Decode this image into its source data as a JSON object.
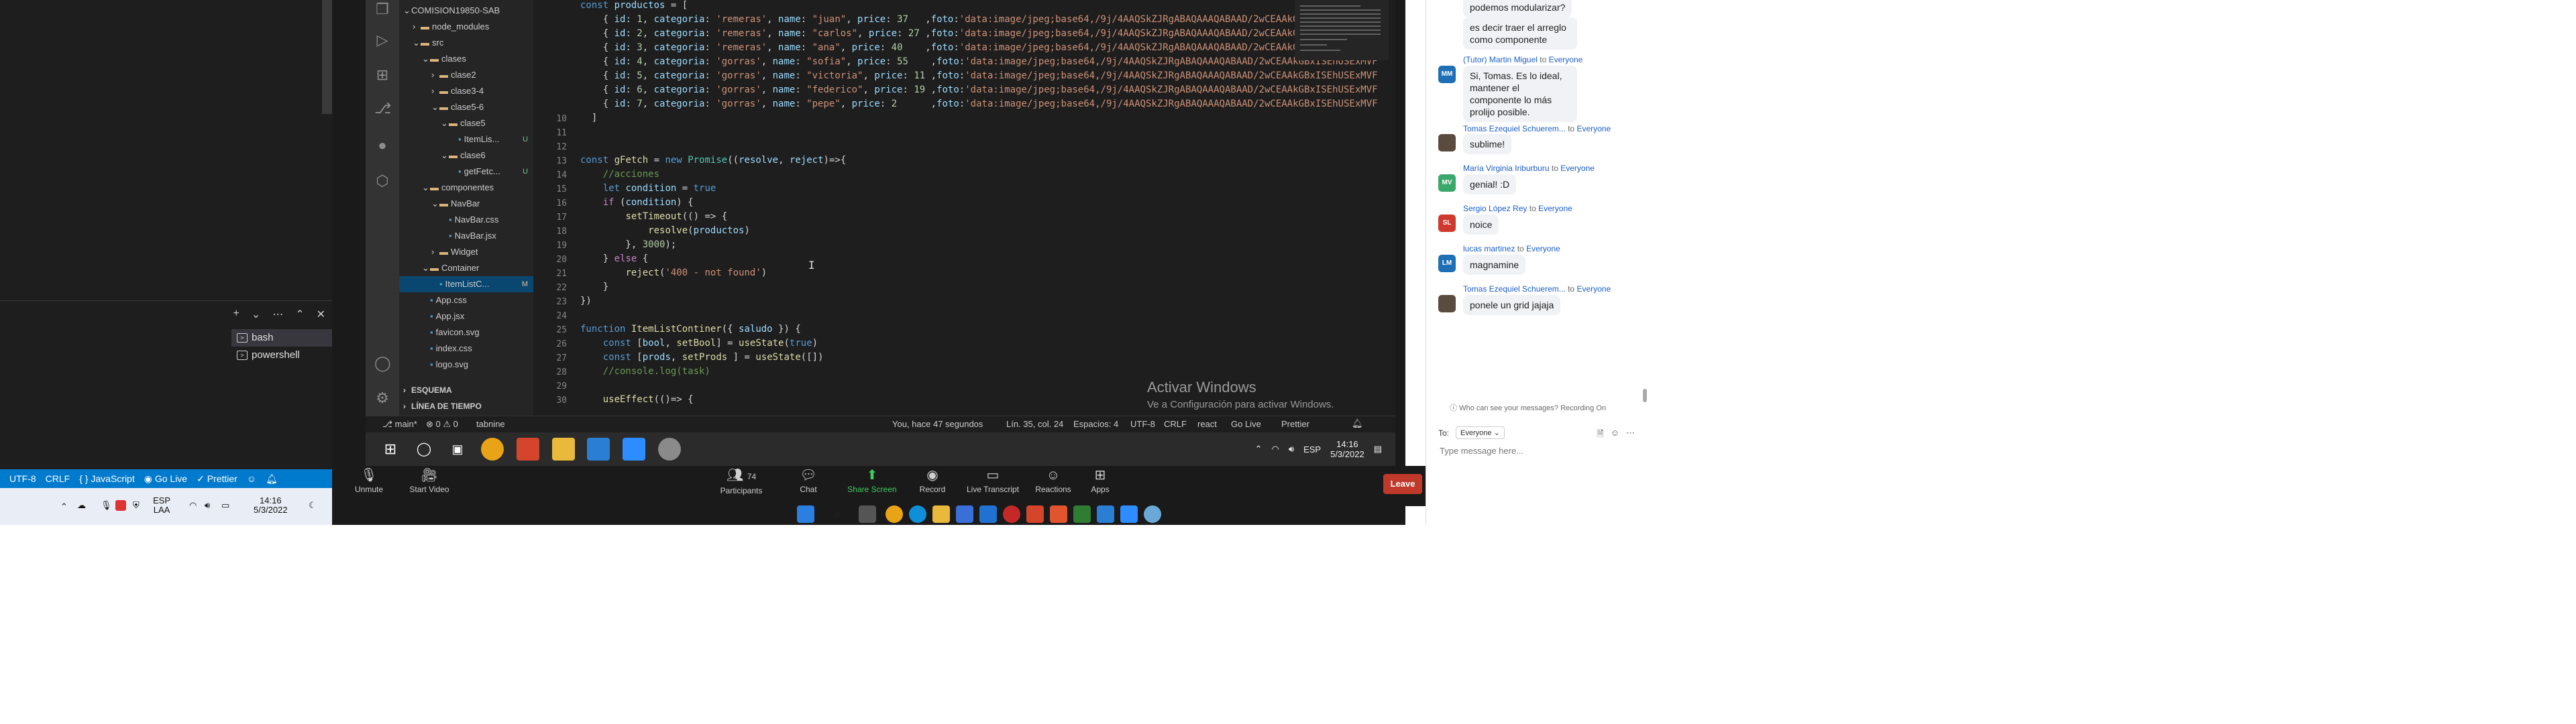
{
  "left_terminal": {
    "toolbar": [
      "+",
      "⌄",
      "⋯",
      "⌃",
      "✕"
    ],
    "items": [
      {
        "label": "bash",
        "active": true
      },
      {
        "label": "powershell",
        "active": false
      }
    ]
  },
  "left_status": {
    "encoding": "UTF-8",
    "eol": "CRLF",
    "language": "JavaScript",
    "golive": "Go Live",
    "prettier": "Prettier"
  },
  "left_taskbar": {
    "lang": "ESP",
    "layout": "LAA",
    "time": "14:16",
    "date": "5/3/2022"
  },
  "remote_explorer": {
    "rows": [
      {
        "text": "COMISION19850-SAB",
        "indent": 0,
        "type": "root"
      },
      {
        "text": "node_modules",
        "indent": 1,
        "type": "folder",
        "collapsed": true
      },
      {
        "text": "src",
        "indent": 1,
        "type": "folder"
      },
      {
        "text": "clases",
        "indent": 2,
        "type": "folder"
      },
      {
        "text": "clase2",
        "indent": 3,
        "type": "folder",
        "collapsed": true
      },
      {
        "text": "clase3-4",
        "indent": 3,
        "type": "folder",
        "collapsed": true
      },
      {
        "text": "clase5-6",
        "indent": 3,
        "type": "folder"
      },
      {
        "text": "clase5",
        "indent": 4,
        "type": "folder"
      },
      {
        "text": "ItemLis...",
        "indent": 5,
        "type": "file",
        "mark": "U"
      },
      {
        "text": "clase6",
        "indent": 4,
        "type": "folder"
      },
      {
        "text": "getFetc...",
        "indent": 5,
        "type": "file",
        "mark": "U"
      },
      {
        "text": "componentes",
        "indent": 2,
        "type": "folder"
      },
      {
        "text": "NavBar",
        "indent": 3,
        "type": "folder"
      },
      {
        "text": "NavBar.css",
        "indent": 4,
        "type": "file"
      },
      {
        "text": "NavBar.jsx",
        "indent": 4,
        "type": "file"
      },
      {
        "text": "Widget",
        "indent": 3,
        "type": "folder",
        "collapsed": true
      },
      {
        "text": "Container",
        "indent": 2,
        "type": "folder"
      },
      {
        "text": "ItemListC...",
        "indent": 3,
        "type": "file",
        "mark": "M",
        "selected": true
      },
      {
        "text": "App.css",
        "indent": 2,
        "type": "file"
      },
      {
        "text": "App.jsx",
        "indent": 2,
        "type": "file"
      },
      {
        "text": "favicon.svg",
        "indent": 2,
        "type": "file"
      },
      {
        "text": "index.css",
        "indent": 2,
        "type": "file"
      },
      {
        "text": "logo.svg",
        "indent": 2,
        "type": "file"
      }
    ],
    "outline": "ESQUEMA",
    "timeline": "LÍNEA DE TIEMPO"
  },
  "remote_code": {
    "line_numbers": [
      "",
      "",
      "",
      "",
      "",
      "",
      "",
      "",
      "10",
      "11",
      "12",
      "13",
      "14",
      "15",
      "16",
      "17",
      "18",
      "19",
      "20",
      "21",
      "22",
      "23",
      "24",
      "25",
      "26",
      "27",
      "28",
      "29",
      "30"
    ],
    "activate_title": "Activar Windows",
    "activate_sub": "Ve a Configuración para activar Windows."
  },
  "remote_status": {
    "branch": "main*",
    "errors": "⊗ 0 ⚠ 0",
    "tabnine": "tabnine",
    "blame": "You, hace 47 segundos",
    "position": "Lín. 35, col. 24",
    "spaces": "Espacios: 4",
    "encoding": "UTF-8",
    "eol": "CRLF",
    "lang": "react",
    "golive": "Go Live",
    "prettier": "Prettier"
  },
  "remote_tray": {
    "lang": "ESP",
    "time": "14:16",
    "date": "5/3/2022"
  },
  "zoom_controls": {
    "unmute": "Unmute",
    "start_video": "Start Video",
    "participants": "Participants",
    "participants_count": "74",
    "chat": "Chat",
    "share": "Share Screen",
    "record": "Record",
    "transcript": "Live Transcript",
    "reactions": "Reactions",
    "apps": "Apps",
    "leave": "Leave"
  },
  "chat": {
    "messages": [
      {
        "sender": "",
        "to": "",
        "text": "podemos modularizar?",
        "initials": "",
        "color": ""
      },
      {
        "sender": "",
        "to": "",
        "text": "es decir traer el arreglo como componente",
        "initials": "",
        "color": ""
      },
      {
        "sender": "(Tutor) Martin Miguel",
        "to": "Everyone",
        "text": "Si, Tomas. Es lo ideal, mantener el componente lo más prolijo posible.",
        "initials": "MM",
        "color": "#1e6fb5"
      },
      {
        "sender": "Tomas Ezequiel Schuerem...",
        "to": "Everyone",
        "text": "sublime!",
        "initials": "",
        "color": "#5b4b3f"
      },
      {
        "sender": "María Virginia Iriburburu",
        "to": "Everyone",
        "text": "genial! :D",
        "initials": "MV",
        "color": "#3aa86b"
      },
      {
        "sender": "Sergio López Rey",
        "to": "Everyone",
        "text": "noice",
        "initials": "SL",
        "color": "#d03a2e"
      },
      {
        "sender": "lucas martinez",
        "to": "Everyone",
        "text": "magnamine",
        "initials": "LM",
        "color": "#1e6fb5"
      },
      {
        "sender": "Tomas Ezequiel Schuerem...",
        "to": "Everyone",
        "text": "ponele un grid jajaja",
        "initials": "",
        "color": "#5b4b3f"
      }
    ],
    "footer_note": "Who can see your messages? Recording On",
    "to_label": "To:",
    "to_value": "Everyone",
    "input_placeholder": "Type message here..."
  }
}
